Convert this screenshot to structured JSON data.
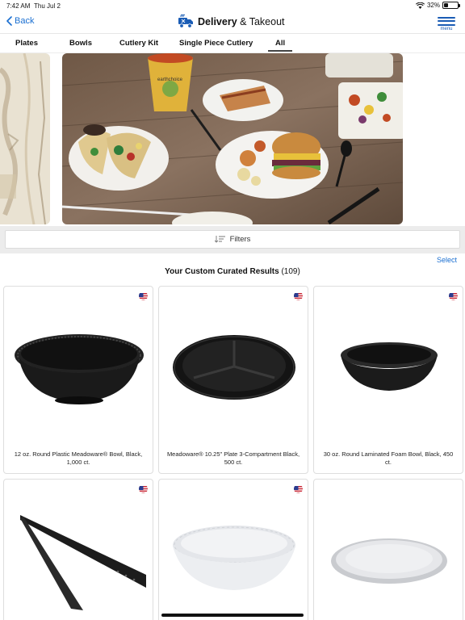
{
  "status_bar": {
    "time": "7:42 AM",
    "date": "Thu Jul 2",
    "battery": "32%",
    "battery_level": 0.32
  },
  "nav": {
    "back_label": "Back",
    "title_bold": "Delivery",
    "title_rest": "& Takeout",
    "menu_label": "menu"
  },
  "tabs": [
    {
      "label": "Plates"
    },
    {
      "label": "Bowls"
    },
    {
      "label": "Cutlery Kit"
    },
    {
      "label": "Single Piece Cutlery"
    },
    {
      "label": "All",
      "active": true
    }
  ],
  "hero": {
    "cup_text": "earthchoice"
  },
  "filters": {
    "label": "Filters"
  },
  "select_label": "Select",
  "results": {
    "title": "Your Custom Curated Results",
    "count": "(109)"
  },
  "products": [
    {
      "name": "12 oz. Round Plastic Meadoware® Bowl, Black, 1,000 ct.",
      "icon": "black-bowl",
      "flag": "us-flag"
    },
    {
      "name": "Meadoware® 10.25\" Plate 3-Compartment Black, 500 ct.",
      "icon": "black-compartment-plate",
      "flag": "us-flag"
    },
    {
      "name": "30 oz. Round Laminated Foam Bowl, Black, 450 ct.",
      "icon": "black-foam-bowl",
      "flag": "us-flag"
    },
    {
      "name": "",
      "icon": "black-tongs",
      "flag": "us-flag"
    },
    {
      "name": "",
      "icon": "white-foam-bowl",
      "flag": "us-flag"
    },
    {
      "name": "",
      "icon": "white-oval-plate",
      "flag": ""
    }
  ],
  "colors": {
    "accent": "#1a6fd1",
    "brand_blue": "#1a5cb5"
  }
}
